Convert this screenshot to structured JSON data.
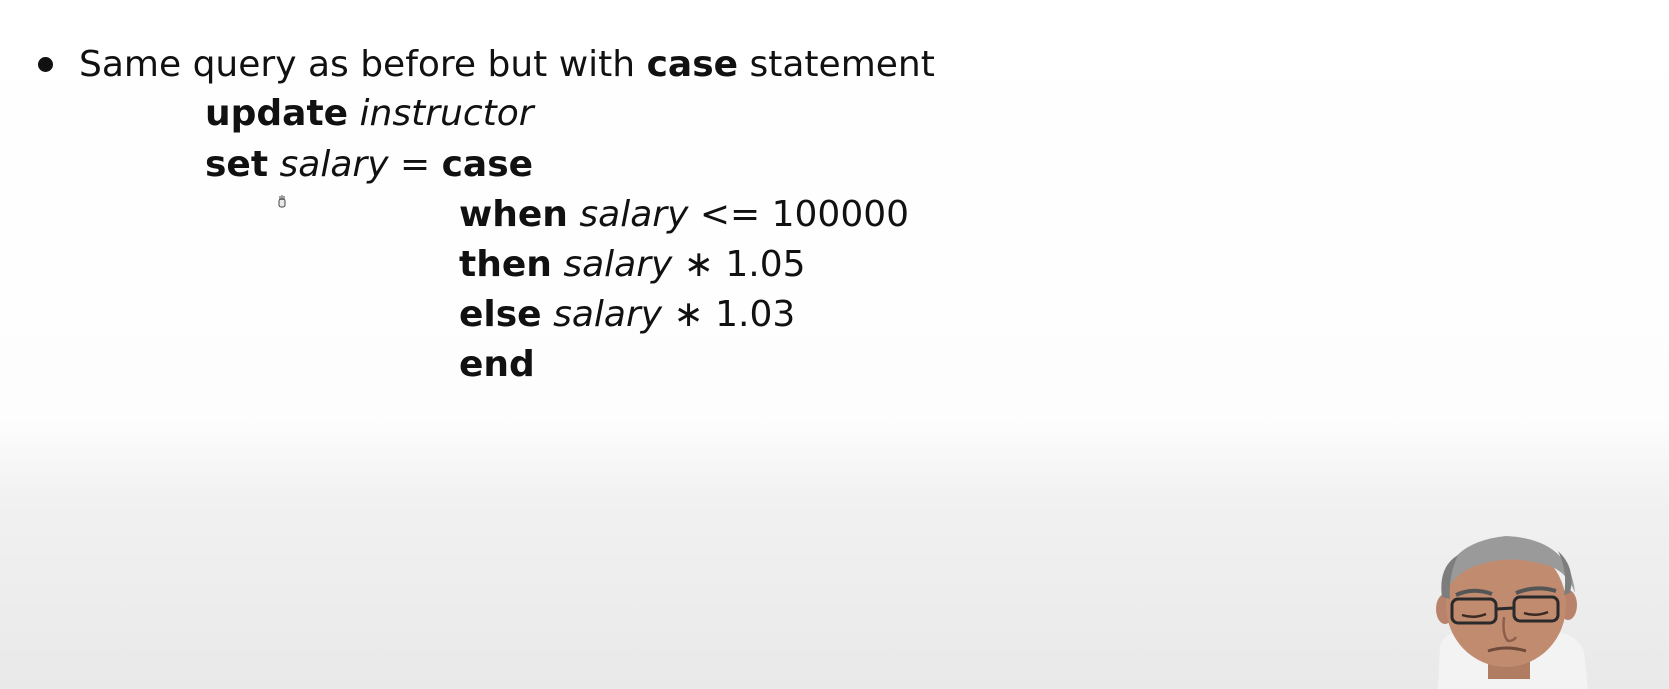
{
  "bullet": {
    "text_before": "Same query as before but with",
    "keyword": "case",
    "text_after": "statement"
  },
  "code": {
    "line1": {
      "keyword": "update",
      "table": "instructor"
    },
    "line2": {
      "keyword": "set",
      "column": "salary",
      "operator": "=",
      "keyword2": "case"
    },
    "line3": {
      "keyword": "when",
      "column": "salary",
      "operator": "<=",
      "value": "100000"
    },
    "line4": {
      "keyword": "then",
      "column": "salary",
      "operator": "∗",
      "value": "1.05"
    },
    "line5": {
      "keyword": "else",
      "column": "salary",
      "operator": "∗",
      "value": "1.03"
    },
    "line6": {
      "keyword": "end"
    }
  },
  "icons": {
    "cursor": "hand-cursor-icon",
    "presenter": "presenter-video-overlay"
  }
}
